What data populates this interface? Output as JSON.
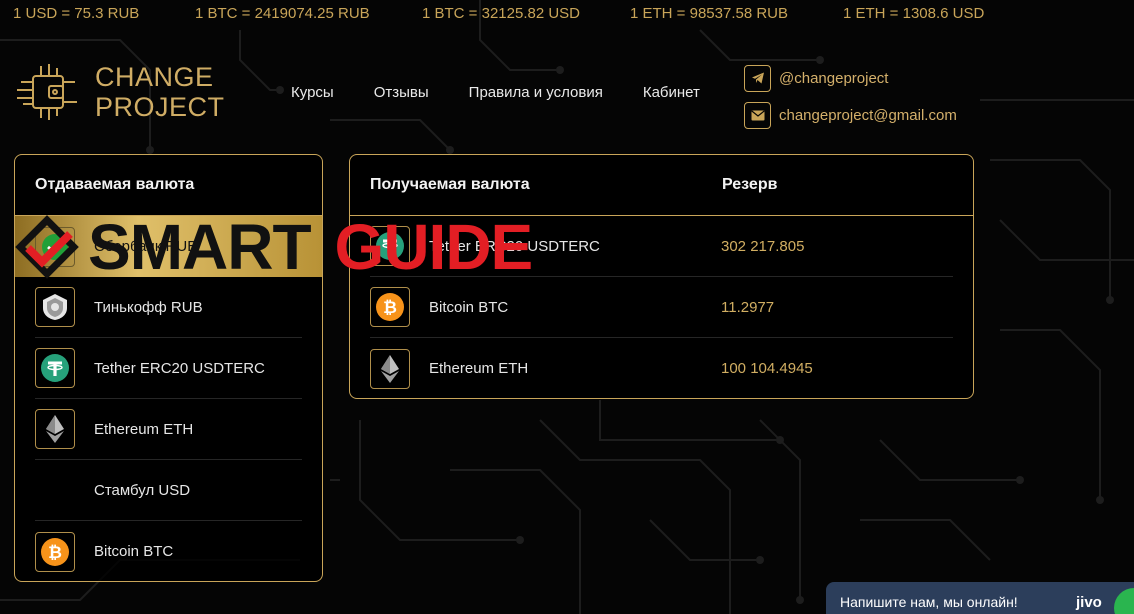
{
  "ticker": [
    "1 USD = 75.3 RUB",
    "1 BTC = 2419074.25 RUB",
    "1 BTC = 32125.82 USD",
    "1 ETH = 98537.58 RUB",
    "1 ETH = 1308.6 USD"
  ],
  "logo": {
    "line1": "CHANGE",
    "line2": "PROJECT"
  },
  "nav": [
    "Курсы",
    "Отзывы",
    "Правила и условия",
    "Кабинет"
  ],
  "contacts": {
    "telegram": "@changeproject",
    "email": "changeproject@gmail.com"
  },
  "give": {
    "title": "Отдаваемая валюта",
    "items": [
      {
        "label": "Сбербанк RUB",
        "icon": "sberbank-icon"
      },
      {
        "label": "Тинькофф RUB",
        "icon": "tinkoff-icon"
      },
      {
        "label": "Tether ERC20 USDTERC",
        "icon": "tether-icon"
      },
      {
        "label": "Ethereum ETH",
        "icon": "ethereum-icon"
      },
      {
        "label": "Стамбул USD",
        "icon": ""
      },
      {
        "label": "Bitcoin BTC",
        "icon": "bitcoin-icon"
      }
    ]
  },
  "receive": {
    "title": "Получаемая валюта",
    "reserve_title": "Резерв",
    "items": [
      {
        "label": "Tether ERC20 USDTERC",
        "reserve": "302 217.805"
      },
      {
        "label": "Bitcoin BTC",
        "reserve": "11.2977"
      },
      {
        "label": "Ethereum ETH",
        "reserve": "100 104.4945"
      }
    ]
  },
  "watermark": {
    "left": "SMART",
    "right": "GUIDE"
  },
  "chat": {
    "text": "Напишите нам, мы онлайн!",
    "brand": "jivo"
  },
  "colors": {
    "gold": "#c9a559",
    "tether": "#26a17b",
    "bitcoin": "#f7931a",
    "chat": "#2c3e5b"
  }
}
